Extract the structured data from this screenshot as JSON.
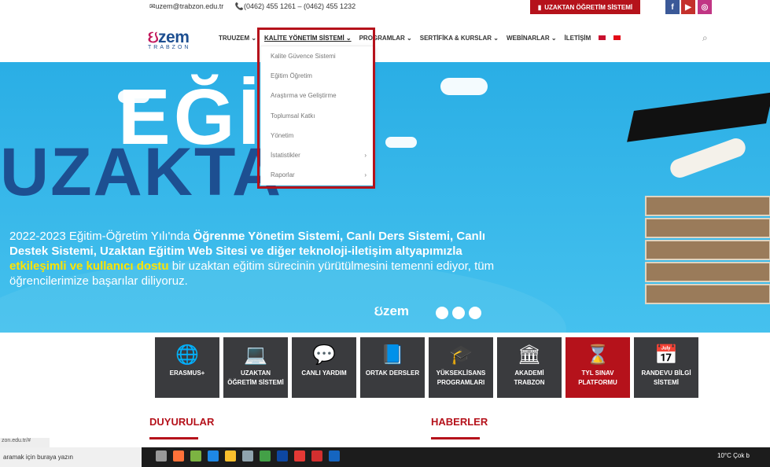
{
  "topbar": {
    "email": "uzem@trabzon.edu.tr",
    "phone": "(0462) 455 1261 – (0462) 455 1232",
    "uzak_button": "UZAKTAN ÖĞRETİM SİSTEMİ",
    "social": [
      "f",
      "▶",
      "◎"
    ]
  },
  "logo": {
    "main": "zem",
    "sub": "TRABZON"
  },
  "nav": {
    "items": [
      "TRUUZEM ⌄",
      "KALİTE YÖNETİM SİSTEMİ ⌄",
      "PROGRAMLAR ⌄",
      "SERTİFİKA & KURSLAR ⌄",
      "WEBİNARLAR ⌄",
      "İLETİŞİM"
    ]
  },
  "dropdown": {
    "items": [
      {
        "label": "Kalite Güvence Sistemi",
        "arrow": ""
      },
      {
        "label": "Eğitim Öğretim",
        "arrow": ""
      },
      {
        "label": "Araştırma ve Geliştirme",
        "arrow": ""
      },
      {
        "label": "Toplumsal Katkı",
        "arrow": ""
      },
      {
        "label": "Yönetim",
        "arrow": ""
      },
      {
        "label": "İstatistikler",
        "arrow": "›"
      },
      {
        "label": "Raporlar",
        "arrow": "›"
      }
    ]
  },
  "hero": {
    "big1": "EĞİT",
    "big2": "UZAKTA",
    "text_parts": [
      "2022-2023 Eğitim-Öğretim Yılı'nda ",
      "Öğrenme Yönetim Sistemi, Canlı Ders Sistemi, Canlı Destek Sistemi, Uzaktan Eğitim Web Sitesi ve diğer teknoloji-iletişim altyapımızla",
      " ",
      "etkileşimli ve kullanıcı dostu",
      " bir uzaktan eğitim sürecinin yürütülmesini temenni ediyor, tüm öğrencilerimize başarılar diliyoruz."
    ],
    "logo": "zem"
  },
  "tiles": [
    {
      "icon": "🌐",
      "label": "ERASMUS+"
    },
    {
      "icon": "💻",
      "label": "UZAKTAN\nÖĞRETİM SİSTEMİ"
    },
    {
      "icon": "💬",
      "label": "CANLI YARDIM"
    },
    {
      "icon": "📘",
      "label": "ORTAK DERSLER"
    },
    {
      "icon": "🎓",
      "label": "YÜKSEKLİSANS\nPROGRAMLARI"
    },
    {
      "icon": "🏛",
      "label": "AKADEMİ\nTRABZON"
    },
    {
      "icon": "⌛",
      "label": "TYL SINAV\nPLATFORMU"
    },
    {
      "icon": "📅",
      "label": "RANDEVU BİLGİ\nSİSTEMİ"
    }
  ],
  "sections": {
    "left": "DUYURULAR",
    "right": "HABERLER"
  },
  "status_url": "zon.edu.tr/#",
  "taskbar": {
    "search": "aramak için buraya yazın",
    "tray": "10°C Çok b"
  }
}
